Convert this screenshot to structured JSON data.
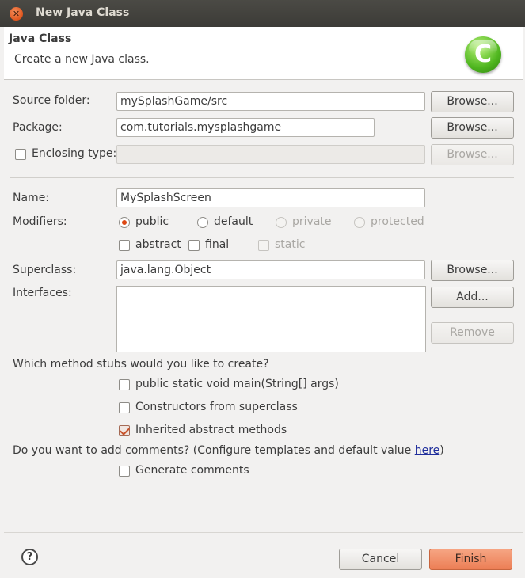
{
  "window": {
    "title": "New Java Class",
    "close_icon": "close-icon"
  },
  "header": {
    "title": "Java Class",
    "subtitle": "Create a new Java class.",
    "logo_letter": "C"
  },
  "form": {
    "source_folder": {
      "label": "Source folder:",
      "value": "mySplashGame/src",
      "button": "Browse..."
    },
    "package": {
      "label": "Package:",
      "value": "com.tutorials.mysplashgame",
      "button": "Browse..."
    },
    "enclosing_type": {
      "label": "Enclosing type:",
      "value": "",
      "button": "Browse...",
      "checked": false
    },
    "name": {
      "label": "Name:",
      "value": "MySplashScreen"
    },
    "modifiers": {
      "label": "Modifiers:",
      "radios": [
        {
          "label": "public",
          "checked": true,
          "enabled": true
        },
        {
          "label": "default",
          "checked": false,
          "enabled": true
        },
        {
          "label": "private",
          "checked": false,
          "enabled": false
        },
        {
          "label": "protected",
          "checked": false,
          "enabled": false
        }
      ],
      "checks": [
        {
          "label": "abstract",
          "checked": false,
          "enabled": true
        },
        {
          "label": "final",
          "checked": false,
          "enabled": true
        },
        {
          "label": "static",
          "checked": false,
          "enabled": false
        }
      ]
    },
    "superclass": {
      "label": "Superclass:",
      "value": "java.lang.Object",
      "button": "Browse..."
    },
    "interfaces": {
      "label": "Interfaces:",
      "add_button": "Add...",
      "remove_button": "Remove"
    },
    "stubs": {
      "question": "Which method stubs would you like to create?",
      "options": [
        {
          "label": "public static void main(String[] args)",
          "checked": false
        },
        {
          "label": "Constructors from superclass",
          "checked": false
        },
        {
          "label": "Inherited abstract methods",
          "checked": true
        }
      ]
    },
    "comments": {
      "question_prefix": "Do you want to add comments? (Configure templates and default value ",
      "link": "here",
      "question_suffix": ")",
      "option": {
        "label": "Generate comments",
        "checked": false
      }
    }
  },
  "footer": {
    "help_icon": "help-icon",
    "cancel": "Cancel",
    "finish": "Finish"
  },
  "colors": {
    "accent": "#dd4814",
    "finish_button": "#ec7e55",
    "titlebar": "#3c3b37",
    "link": "#1f2e9c"
  }
}
